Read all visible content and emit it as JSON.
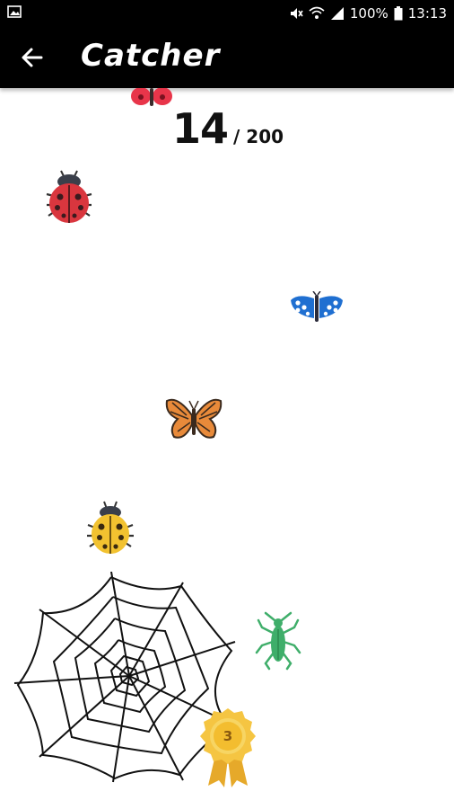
{
  "status_bar": {
    "battery": "100%",
    "time": "13:13",
    "icons": [
      "image-icon",
      "mute-icon",
      "wifi-icon",
      "signal-icon",
      "battery-icon"
    ]
  },
  "app_bar": {
    "title": "Catcher",
    "back_icon": "arrow-left-icon"
  },
  "game": {
    "score_current": "14",
    "score_total": "/ 200",
    "medal_level": "3",
    "colors": {
      "red_bug": "#d9363e",
      "blue_butterfly": "#1f6fd1",
      "orange_butterfly": "#e88a3a",
      "yellow_bug": "#f2c230",
      "green_insect": "#3fae6a",
      "medal_gold": "#f5c542"
    }
  }
}
